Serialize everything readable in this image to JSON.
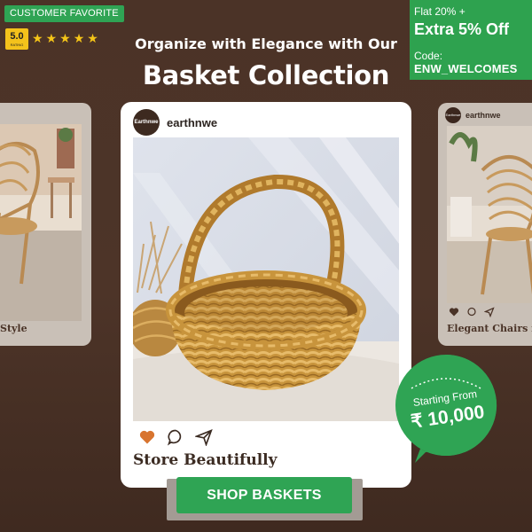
{
  "badges": {
    "customer_favorite": "CUSTOMER FAVORITE",
    "rating_value": "5.0",
    "rating_label": "RATING",
    "stars_count": 5
  },
  "offer": {
    "line1": "Flat 20% +",
    "line2": "Extra 5% Off",
    "code_label": "Code:",
    "code_value": "ENW_WELCOMES"
  },
  "heading": {
    "subtitle": "Organize with Elegance with Our",
    "title": "Basket Collection"
  },
  "main_card": {
    "avatar_text": "Earthnwe",
    "brand": "earthnwe",
    "caption": "Store Beautifully",
    "icons": [
      "heart-icon",
      "comment-icon",
      "share-icon"
    ]
  },
  "left_card": {
    "caption": "Style"
  },
  "right_card": {
    "avatar_text": "Earthnwe",
    "brand": "earthnwe",
    "caption": "Elegant Chairs f"
  },
  "sticker": {
    "label": "Starting From",
    "price": "₹ 10,000"
  },
  "cta": {
    "label": "SHOP BASKETS"
  },
  "colors": {
    "background": "#4b3327",
    "accent_green": "#2fa454",
    "star_yellow": "#f5c518",
    "heart_orange": "#d8742f"
  }
}
